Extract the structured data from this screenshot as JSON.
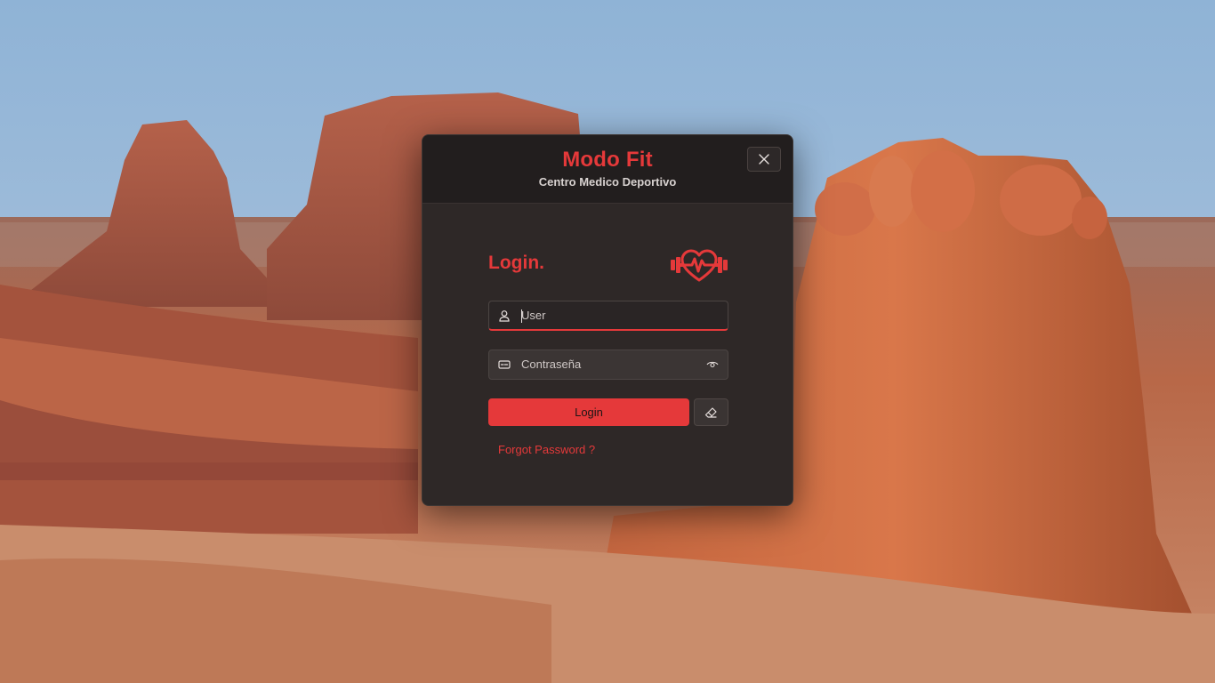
{
  "app": {
    "title": "Modo Fit",
    "subtitle": "Centro Medico Deportivo"
  },
  "login": {
    "heading": "Login.",
    "user_placeholder": "User",
    "password_placeholder": "Contraseña",
    "submit_label": "Login",
    "forgot_label": "Forgot Password ?"
  },
  "icons": {
    "close": "close-icon",
    "brand": "heart-dumbbell-icon",
    "user": "user-icon",
    "password": "password-icon",
    "reveal": "eye-icon",
    "clear": "eraser-icon"
  },
  "colors": {
    "accent": "#e5393a",
    "dialog_background": "#2e2827",
    "header_background": "#221e1e"
  }
}
